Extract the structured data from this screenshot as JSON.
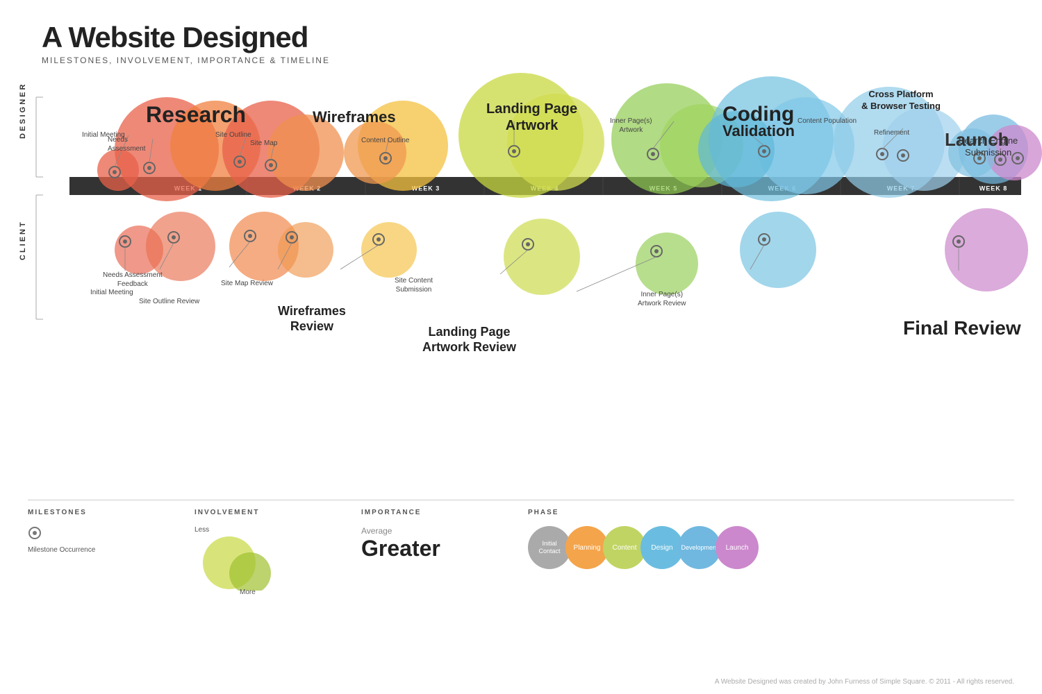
{
  "title": "A Website Designed",
  "subtitle": "MILESTONES, INVOLVEMENT, IMPORTANCE & TIMELINE",
  "weeks": [
    "WEEK 1",
    "WEEK 2",
    "WEEK 3",
    "WEEK 4",
    "WEEK 5",
    "WEEK 6",
    "WEEK 7",
    "WEEK 8"
  ],
  "roles": {
    "designer": "DESIGNER",
    "client": "CLIENT"
  },
  "phases": [
    {
      "name": "Initial\nContact",
      "color": "#aaa"
    },
    {
      "name": "Planning",
      "color": "#f4a44a"
    },
    {
      "name": "Content",
      "color": "#c0d463"
    },
    {
      "name": "Design",
      "color": "#6abde0"
    },
    {
      "name": "Development",
      "color": "#6abde0"
    },
    {
      "name": "Launch",
      "color": "#cc88cc"
    }
  ],
  "annotations": {
    "research": "Research",
    "wireframes": "Wireframes",
    "landing_page_artwork": "Landing Page\nArtwork",
    "coding": "Coding",
    "validation": "Validation",
    "cross_platform": "Cross Platform\n& Browser Testing",
    "launch": "Launch",
    "search_engine": "Search Engine\nSubmission",
    "final_review": "Final Review",
    "initial_meeting_d": "Initial Meeting",
    "needs_assessment": "Needs\nAssessment",
    "site_outline": "Site Outline",
    "site_map": "Site Map",
    "content_outline": "Content Outline",
    "content_population": "Content Population",
    "refinement": "Refinement",
    "inner_pages_artwork": "Inner Page(s)\nArtwork",
    "needs_assessment_feedback": "Needs Assessment\nFeedback",
    "initial_meeting_c": "Initial Meeting",
    "site_outline_review": "Site Outline Review",
    "site_map_review": "Site Map Review",
    "wireframes_review": "Wireframes\nReview",
    "site_content_submission": "Site Content\nSubmission",
    "landing_page_review": "Landing Page\nArtwork Review",
    "inner_pages_review": "Inner Page(s)\nArtwork Review",
    "designer_label": "DESIGNER",
    "client_label": "CLIENT"
  },
  "legend": {
    "milestones_title": "MILESTONES",
    "milestone_occurrence": "Milestone Occurrence",
    "involvement_title": "INVOLVEMENT",
    "involvement_less": "Less",
    "involvement_more": "More",
    "importance_title": "IMPORTANCE",
    "importance_average": "Average",
    "importance_greater": "Greater",
    "phase_title": "PHASE"
  },
  "footer": "A Website Designed was created by John Furness of Simple Square. © 2011 - All rights reserved."
}
